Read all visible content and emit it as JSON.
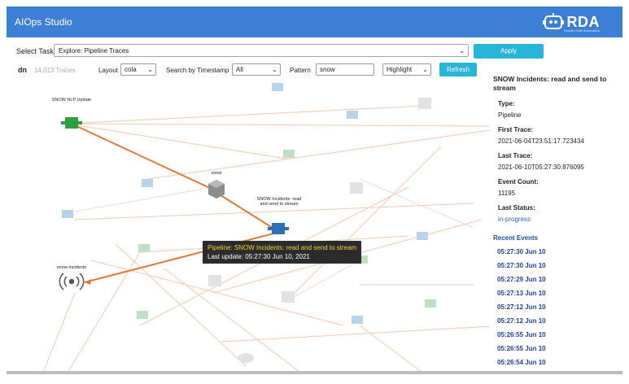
{
  "app": {
    "title": "AIOps Studio",
    "brand": "RDA",
    "brand_tagline": "Robotic Data Automation"
  },
  "toolbar": {
    "select_task_label": "Select Task",
    "select_task_value": "Explore: Pipeline Traces",
    "apply_label": "Apply",
    "dn_label": "dn",
    "trace_count": "14,013 Traces",
    "layout_label": "Layout",
    "layout_value": "cola",
    "search_label": "Search by Timestamp",
    "search_value": "All",
    "pattern_label": "Pattern",
    "pattern_value": "snow",
    "highlight_value": "Highlight",
    "refresh_label": "Refresh"
  },
  "graph": {
    "nodes": {
      "snow_nlp": "SNOW NLP Update",
      "snow": "snow",
      "snow_incidents_stream": "SNOW Incidents: read and send to stream",
      "snow_incidents": "snow-incidents"
    },
    "tooltip": {
      "line1": "Pipeline: SNOW Incidents: read and send to stream",
      "line2": "Last update: 05:27:30 Jun 10, 2021"
    }
  },
  "panel": {
    "title": "SNOW Incidents: read and send to stream",
    "type_label": "Type:",
    "type_value": "Pipeline",
    "first_label": "First Trace:",
    "first_value": "2021-06-04T23:51:17.723434",
    "last_label": "Last Trace:",
    "last_value": "2021-06-10T05:27:30.876095",
    "count_label": "Event Count:",
    "count_value": "11195",
    "status_label": "Last Status:",
    "status_value": "in-progress",
    "recent_label": "Recent Events",
    "events": [
      "05:27:30 Jun 10",
      "05:27:30 Jun 10",
      "05:27:29 Jun 10",
      "05:27:13 Jun 10",
      "05:27:12 Jun 10",
      "05:27:12 Jun 10",
      "05:26:55 Jun 10",
      "05:26:55 Jun 10",
      "05:26:54 Jun 10"
    ]
  },
  "colors": {
    "header": "#3e7fd6",
    "accent": "#29b5d8",
    "highlight_edge": "#e07a3a",
    "active_node": "#2e9e3e",
    "faint_node": "#a9c6e3"
  }
}
